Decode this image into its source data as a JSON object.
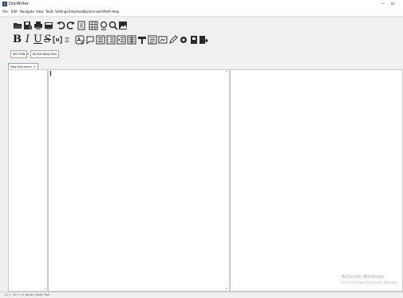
{
  "window": {
    "title": "DocWriter",
    "minimize_glyph": "–",
    "maximize_glyph": "▫"
  },
  "menu": [
    "File",
    "Edit",
    "Navigate",
    "View",
    "Tools",
    "Settings",
    "Emphasis",
    "Styles",
    "Insert",
    "Math",
    "Help"
  ],
  "toolbar_row1": [
    {
      "name": "open-folder-icon"
    },
    {
      "name": "save-icon"
    },
    {
      "name": "print-icon"
    },
    {
      "name": "print-preview-icon"
    },
    {
      "name": "undo-icon"
    },
    {
      "name": "redo-icon"
    },
    {
      "name": "document-icon"
    },
    {
      "name": "table-icon"
    },
    {
      "name": "spellcheck-icon"
    },
    {
      "name": "find-icon"
    },
    {
      "name": "image-icon"
    }
  ],
  "toolbar_row2": [
    {
      "name": "bold-icon",
      "letter": "B"
    },
    {
      "name": "italic-icon",
      "letter": "I"
    },
    {
      "name": "underline-icon",
      "letter": "U"
    },
    {
      "name": "strikethrough-icon",
      "letter": "S"
    },
    {
      "name": "bracket-icon"
    },
    {
      "name": "symbol-icon"
    },
    {
      "name": "subscript-icon"
    },
    {
      "name": "comment-icon"
    },
    {
      "name": "list-icon"
    },
    {
      "name": "numbered-list-icon"
    },
    {
      "name": "indent-icon"
    },
    {
      "name": "outdent-icon"
    },
    {
      "name": "align-icon"
    },
    {
      "name": "paragraph-icon"
    },
    {
      "name": "link-icon"
    },
    {
      "name": "pencil-icon"
    },
    {
      "name": "gear-icon"
    },
    {
      "name": "block-icon"
    },
    {
      "name": "export-icon"
    }
  ],
  "breadcrumb": {
    "section": "SECTION",
    "separator": "»",
    "block": "BLOCK Body Text"
  },
  "tab": {
    "label": "New Document",
    "close": "×"
  },
  "watermark": {
    "line1": "Activate Windows",
    "line2": "Go to Settings to activate Windows."
  },
  "status": "Ln 1, Col 1   |   0 words   |   Body Text"
}
